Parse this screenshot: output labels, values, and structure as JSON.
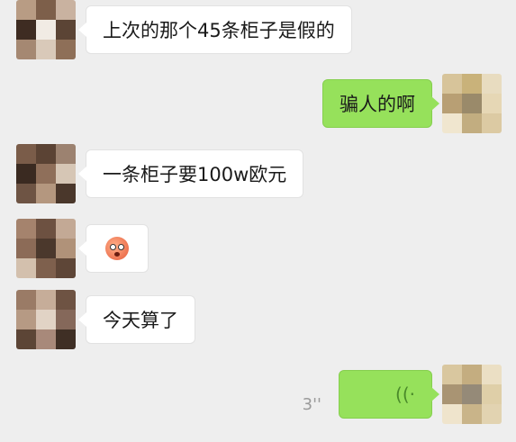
{
  "messages": [
    {
      "side": "incoming",
      "text": "上次的那个45条柜子是假的"
    },
    {
      "side": "outgoing",
      "text": "骗人的啊"
    },
    {
      "side": "incoming",
      "text": "一条柜子要100w欧元"
    },
    {
      "side": "incoming",
      "emoji": "flushed-face-emoji"
    },
    {
      "side": "incoming",
      "text": "今天算了"
    },
    {
      "side": "outgoing",
      "voice_duration": "3''"
    }
  ],
  "colors": {
    "background": "#eeeeee",
    "incoming_bubble": "#ffffff",
    "outgoing_bubble": "#96e15b"
  }
}
